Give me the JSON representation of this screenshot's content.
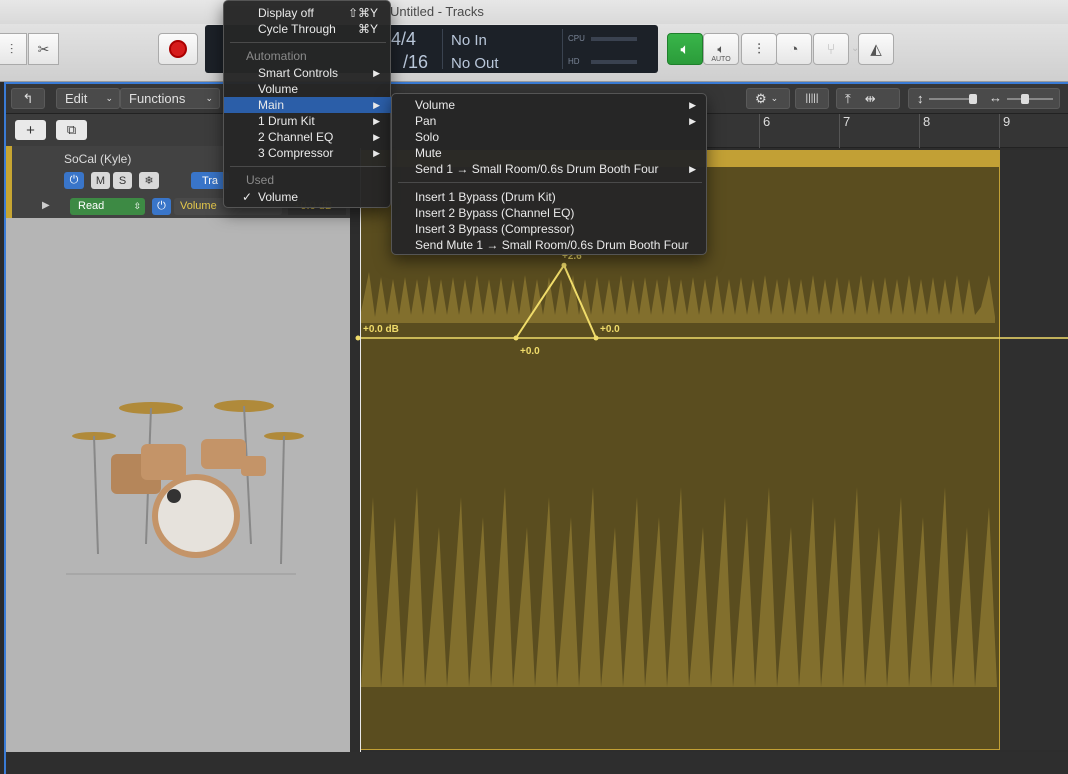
{
  "window": {
    "title": "Untitled - Tracks"
  },
  "toolbar": {
    "lcd": {
      "sig_top": "4/4",
      "sig_bottom": "/16",
      "in": "No In",
      "out": "No Out",
      "cpu": "CPU",
      "hd": "HD"
    },
    "auto_label": "AUTO"
  },
  "track_header": {
    "edit": "Edit",
    "functions": "Functions"
  },
  "track": {
    "name": "SoCal (Kyle)",
    "mute": "M",
    "solo": "S",
    "freeze": "❄",
    "tracks_btn": "Tra",
    "mode": "Read",
    "param": "Volume",
    "value": "+0.0 dB"
  },
  "ruler": {
    "bars": [
      "6",
      "7",
      "8",
      "9"
    ]
  },
  "automation": {
    "start_label": "+0.0 dB",
    "points": [
      {
        "time_bar": 2.95,
        "value_db": 0.0,
        "label": "+0.0"
      },
      {
        "time_bar": 3.55,
        "value_db": 2.6,
        "label": "+2.6"
      },
      {
        "time_bar": 3.95,
        "value_db": 0.0,
        "label": "+0.0"
      }
    ]
  },
  "menu_primary": {
    "display_off": "Display off",
    "display_off_key": "⇧⌘Y",
    "cycle": "Cycle Through",
    "cycle_key": "⌘Y",
    "automation_header": "Automation",
    "items": [
      "Smart Controls",
      "Volume",
      "Main",
      "1 Drum Kit",
      "2 Channel EQ",
      "3 Compressor"
    ],
    "used_header": "Used",
    "used_item": "Volume"
  },
  "menu_main": {
    "items": [
      "Volume",
      "Pan",
      "Solo",
      "Mute",
      "Send 1 → Small Room/0.6s Drum Booth Four"
    ],
    "items2": [
      "Insert 1 Bypass (Drum Kit)",
      "Insert 2 Bypass (Channel EQ)",
      "Insert 3 Bypass (Compressor)",
      "Send Mute 1 → Small Room/0.6s Drum Booth Four"
    ]
  },
  "colors": {
    "region": "#5a4d1f",
    "region_top": "#c2a035",
    "automation_line": "#f0dc6a",
    "selection": "#2b5ea8"
  }
}
